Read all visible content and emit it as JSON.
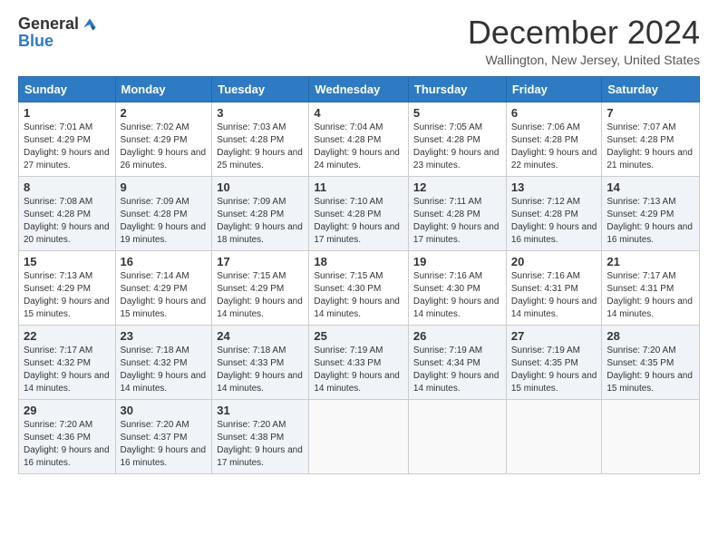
{
  "header": {
    "logo_general": "General",
    "logo_blue": "Blue",
    "month_title": "December 2024",
    "location": "Wallington, New Jersey, United States"
  },
  "days_of_week": [
    "Sunday",
    "Monday",
    "Tuesday",
    "Wednesday",
    "Thursday",
    "Friday",
    "Saturday"
  ],
  "weeks": [
    [
      {
        "day": "1",
        "sunrise": "7:01 AM",
        "sunset": "4:29 PM",
        "daylight": "9 hours and 27 minutes."
      },
      {
        "day": "2",
        "sunrise": "7:02 AM",
        "sunset": "4:29 PM",
        "daylight": "9 hours and 26 minutes."
      },
      {
        "day": "3",
        "sunrise": "7:03 AM",
        "sunset": "4:28 PM",
        "daylight": "9 hours and 25 minutes."
      },
      {
        "day": "4",
        "sunrise": "7:04 AM",
        "sunset": "4:28 PM",
        "daylight": "9 hours and 24 minutes."
      },
      {
        "day": "5",
        "sunrise": "7:05 AM",
        "sunset": "4:28 PM",
        "daylight": "9 hours and 23 minutes."
      },
      {
        "day": "6",
        "sunrise": "7:06 AM",
        "sunset": "4:28 PM",
        "daylight": "9 hours and 22 minutes."
      },
      {
        "day": "7",
        "sunrise": "7:07 AM",
        "sunset": "4:28 PM",
        "daylight": "9 hours and 21 minutes."
      }
    ],
    [
      {
        "day": "8",
        "sunrise": "7:08 AM",
        "sunset": "4:28 PM",
        "daylight": "9 hours and 20 minutes."
      },
      {
        "day": "9",
        "sunrise": "7:09 AM",
        "sunset": "4:28 PM",
        "daylight": "9 hours and 19 minutes."
      },
      {
        "day": "10",
        "sunrise": "7:09 AM",
        "sunset": "4:28 PM",
        "daylight": "9 hours and 18 minutes."
      },
      {
        "day": "11",
        "sunrise": "7:10 AM",
        "sunset": "4:28 PM",
        "daylight": "9 hours and 17 minutes."
      },
      {
        "day": "12",
        "sunrise": "7:11 AM",
        "sunset": "4:28 PM",
        "daylight": "9 hours and 17 minutes."
      },
      {
        "day": "13",
        "sunrise": "7:12 AM",
        "sunset": "4:28 PM",
        "daylight": "9 hours and 16 minutes."
      },
      {
        "day": "14",
        "sunrise": "7:13 AM",
        "sunset": "4:29 PM",
        "daylight": "9 hours and 16 minutes."
      }
    ],
    [
      {
        "day": "15",
        "sunrise": "7:13 AM",
        "sunset": "4:29 PM",
        "daylight": "9 hours and 15 minutes."
      },
      {
        "day": "16",
        "sunrise": "7:14 AM",
        "sunset": "4:29 PM",
        "daylight": "9 hours and 15 minutes."
      },
      {
        "day": "17",
        "sunrise": "7:15 AM",
        "sunset": "4:29 PM",
        "daylight": "9 hours and 14 minutes."
      },
      {
        "day": "18",
        "sunrise": "7:15 AM",
        "sunset": "4:30 PM",
        "daylight": "9 hours and 14 minutes."
      },
      {
        "day": "19",
        "sunrise": "7:16 AM",
        "sunset": "4:30 PM",
        "daylight": "9 hours and 14 minutes."
      },
      {
        "day": "20",
        "sunrise": "7:16 AM",
        "sunset": "4:31 PM",
        "daylight": "9 hours and 14 minutes."
      },
      {
        "day": "21",
        "sunrise": "7:17 AM",
        "sunset": "4:31 PM",
        "daylight": "9 hours and 14 minutes."
      }
    ],
    [
      {
        "day": "22",
        "sunrise": "7:17 AM",
        "sunset": "4:32 PM",
        "daylight": "9 hours and 14 minutes."
      },
      {
        "day": "23",
        "sunrise": "7:18 AM",
        "sunset": "4:32 PM",
        "daylight": "9 hours and 14 minutes."
      },
      {
        "day": "24",
        "sunrise": "7:18 AM",
        "sunset": "4:33 PM",
        "daylight": "9 hours and 14 minutes."
      },
      {
        "day": "25",
        "sunrise": "7:19 AM",
        "sunset": "4:33 PM",
        "daylight": "9 hours and 14 minutes."
      },
      {
        "day": "26",
        "sunrise": "7:19 AM",
        "sunset": "4:34 PM",
        "daylight": "9 hours and 14 minutes."
      },
      {
        "day": "27",
        "sunrise": "7:19 AM",
        "sunset": "4:35 PM",
        "daylight": "9 hours and 15 minutes."
      },
      {
        "day": "28",
        "sunrise": "7:20 AM",
        "sunset": "4:35 PM",
        "daylight": "9 hours and 15 minutes."
      }
    ],
    [
      {
        "day": "29",
        "sunrise": "7:20 AM",
        "sunset": "4:36 PM",
        "daylight": "9 hours and 16 minutes."
      },
      {
        "day": "30",
        "sunrise": "7:20 AM",
        "sunset": "4:37 PM",
        "daylight": "9 hours and 16 minutes."
      },
      {
        "day": "31",
        "sunrise": "7:20 AM",
        "sunset": "4:38 PM",
        "daylight": "9 hours and 17 minutes."
      },
      null,
      null,
      null,
      null
    ]
  ],
  "labels": {
    "sunrise": "Sunrise:",
    "sunset": "Sunset:",
    "daylight": "Daylight:"
  }
}
